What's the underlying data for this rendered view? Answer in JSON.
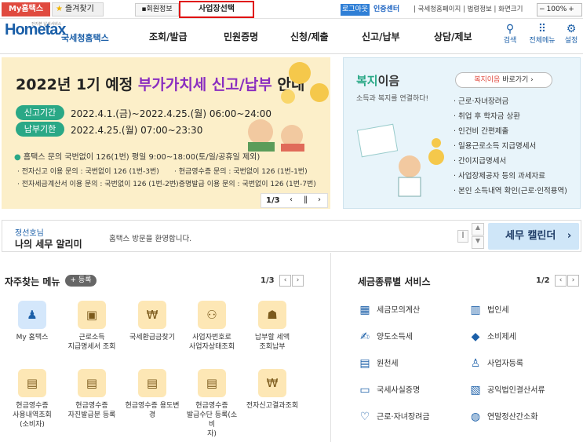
{
  "topbar": {
    "my_hometax": "My홈택스",
    "favorites": "즐겨찾기",
    "member_info": "회원정보",
    "business_select": "사업장선택",
    "logout": "로그아웃",
    "cert_center": "인증센터",
    "links": "| 국세청홈페이지 | 법령정보 | 화면크기",
    "zoom": "100%"
  },
  "header": {
    "logo_main": "Hometax",
    "logo_sub": "국세청홈택스",
    "logo_tiny": "전자본 납세서비스",
    "menu": [
      "조회/발급",
      "민원증명",
      "신청/제출",
      "신고/납부",
      "상담/제보"
    ],
    "tools": [
      "검색",
      "전체메뉴",
      "설정"
    ]
  },
  "banner": {
    "title_prefix": "2022년 1기 예정 ",
    "title_highlight": "부가가치세 신고/납부",
    "title_suffix": " 안내",
    "period_label": "신고기간",
    "period_value": "2022.4.1.(금)~2022.4.25.(월) 06:00~24:00",
    "deadline_label": "납부기한",
    "deadline_value": "2022.4.25.(월) 07:00~23:30",
    "inquiry": "홈택스 문의 국번없이 126(1번) 평일 9:00~18:00(토/일/공휴일 제외)",
    "faq_lines": [
      "· 전자신고 이용 문의 : 국번없이 126 (1번-3번)",
      "· 현금영수증 문의 : 국번없이 126 (1번-1번)",
      "· 전자세금계산서 이용 문의 : 국번없이 126 (1번-2번)",
      "· 증명발급 이용 문의 : 국번없이 126 (1번-7번)"
    ],
    "page": "1/3"
  },
  "welfare": {
    "title_a": "복지",
    "title_b": "이음",
    "subtitle": "소득과 복지를 연결하다!",
    "button_a": "복지이음",
    "button_b": " 바로가기",
    "items": [
      "근로·자녀장려금",
      "취업 후 학자금 상환",
      "인건비 간편제출",
      "일용근로소득 지급명세서",
      "간이지급명세서",
      "사업장제공자 등의 과세자료",
      "본인 소득내역 확인(근로·인적용역)"
    ]
  },
  "notice": {
    "greeting": "정선호님",
    "title": "나의 세무 알리미",
    "message": "홈택스 방문을 환영합니다.",
    "calendar_button": "세무 캘린더"
  },
  "quick_menu": {
    "title": "자주찾는 메뉴",
    "add_label": "등록",
    "page": "1/3",
    "items": [
      "My 홈택스",
      "근로소득\n지급명세서 조회",
      "국세환급금찾기",
      "사업자번호로\n사업자상태조회",
      "납부할 세액\n조회납부",
      "현금영수증\n사용내역조회\n(소비자)",
      "현금영수증\n자진발급분 등록",
      "현금영수증 용도변\n경",
      "현금영수증\n발급수단 등록(소비\n자)",
      "전자신고결과조회"
    ]
  },
  "tax_services": {
    "title": "세금종류별 서비스",
    "page": "1/2",
    "items": [
      "세금모의계산",
      "법인세",
      "양도소득세",
      "소비제세",
      "원천세",
      "사업자등록",
      "국세사실증명",
      "공익법인결산서류",
      "근로·자녀장려금",
      "연말정산간소화"
    ]
  }
}
